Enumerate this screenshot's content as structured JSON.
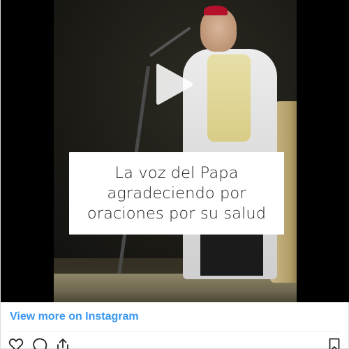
{
  "post": {
    "caption_lines": [
      "La voz del Papa",
      "agradeciendo por",
      "oraciones por su salud"
    ]
  },
  "footer": {
    "view_more_label": "View more on Instagram",
    "link_color": "#3897f0"
  },
  "actions": {
    "icons": [
      "heart-icon",
      "comment-icon",
      "share-icon",
      "bookmark-icon"
    ]
  },
  "colors": {
    "media_background": "#000000",
    "caption_card": "#ffffff",
    "cardinal_red": "#b3122a"
  }
}
